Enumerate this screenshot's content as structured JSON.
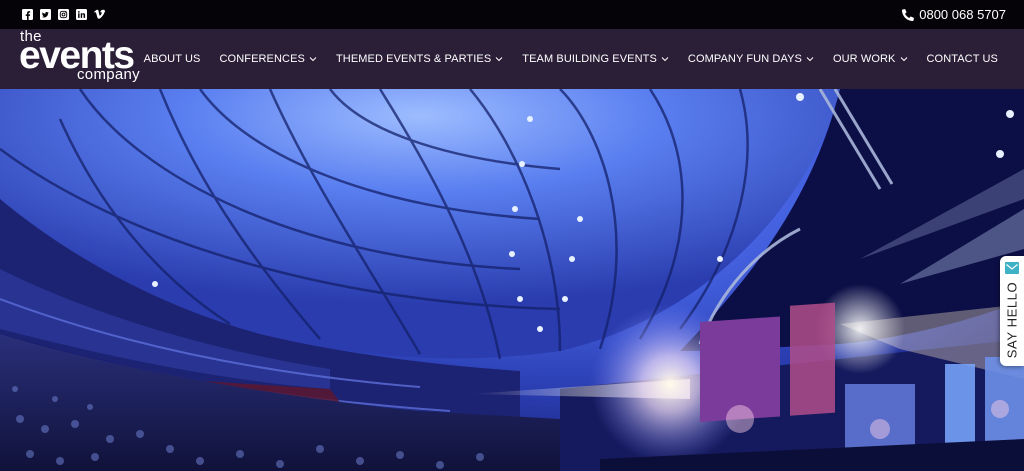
{
  "topbar": {
    "socials": [
      "facebook-icon",
      "twitter-icon",
      "instagram-icon",
      "linkedin-icon",
      "vimeo-icon"
    ],
    "phone": "0800 068 5707"
  },
  "logo": {
    "line1": "the",
    "line2": "events",
    "line3": "company"
  },
  "nav": {
    "items": [
      {
        "label": "ABOUT US",
        "dropdown": false
      },
      {
        "label": "CONFERENCES",
        "dropdown": true
      },
      {
        "label": "THEMED EVENTS & PARTIES",
        "dropdown": true
      },
      {
        "label": "TEAM BUILDING EVENTS",
        "dropdown": true
      },
      {
        "label": "COMPANY FUN DAYS",
        "dropdown": true
      },
      {
        "label": "OUR WORK",
        "dropdown": true
      },
      {
        "label": "CONTACT US",
        "dropdown": false
      }
    ]
  },
  "say_hello": {
    "label": "SAY HELLO",
    "icon": "mail-icon"
  },
  "colors": {
    "topbar_bg": "#050307",
    "header_bg": "#2b1f38",
    "accent": "#3fb3c5"
  }
}
